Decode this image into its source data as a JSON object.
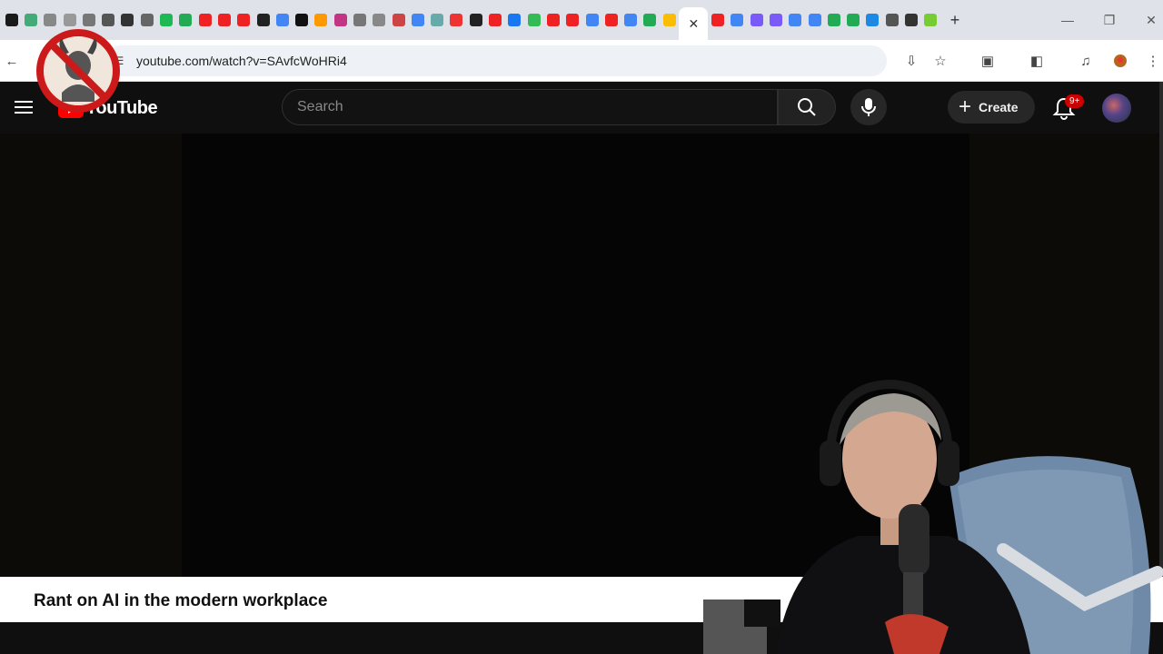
{
  "browser": {
    "url": "youtube.com/watch?v=SAvfcWoHRi4"
  },
  "youtube": {
    "logo_text": "YouTube",
    "search_placeholder": "Search",
    "create_label": "Create",
    "notification_badge": "9+"
  },
  "video": {
    "title": "Rant on AI in the modern workplace"
  },
  "colors": {
    "yt_red": "#ff0000",
    "header_bg": "#0f0f0f",
    "tabstrip_bg": "#dfe3e9"
  },
  "tab_favicon_colors": [
    "#1a1a1a",
    "#4a7",
    "#888",
    "#999",
    "#777",
    "#555",
    "#333",
    "#666",
    "#1db954",
    "#2a5",
    "#e22",
    "#e22",
    "#e22",
    "#222",
    "#4285f4",
    "#111",
    "#ff9900",
    "#c13584",
    "#777",
    "#888",
    "#c44",
    "#4285f4",
    "#6aa",
    "#e33",
    "#222",
    "#e22",
    "#1877f2",
    "#3b5",
    "#e22",
    "#e22",
    "#4285f4",
    "#e22",
    "#4285f4",
    "#2a5",
    "#fbbc04"
  ],
  "tab_favicon_colors_right": [
    "#e22",
    "#4285f4",
    "#7a5af8",
    "#7a5af8",
    "#4285f4",
    "#4285f4",
    "#2a5",
    "#2a5",
    "#1e88e5",
    "#555",
    "#333",
    "#7c3"
  ]
}
